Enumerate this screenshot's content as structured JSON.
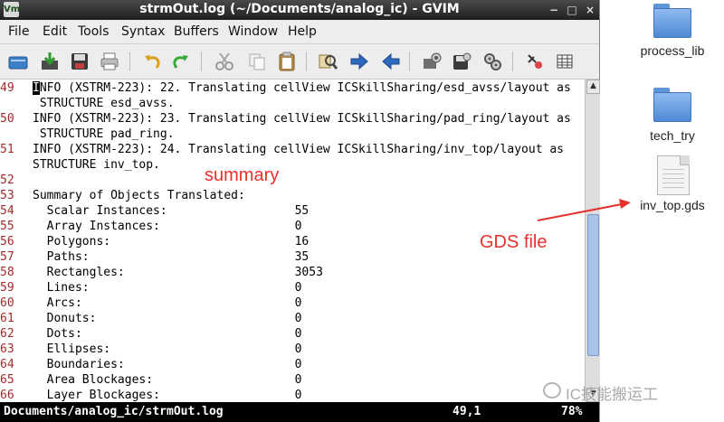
{
  "window": {
    "title": "strmOut.log (~/Documents/analog_ic) - GVIM",
    "logo_text": "Vm",
    "min_label": "−",
    "max_label": "□",
    "close_label": "×"
  },
  "menu": [
    "File",
    "Edit",
    "Tools",
    "Syntax",
    "Buffers",
    "Window",
    "Help"
  ],
  "toolbar_icons": [
    "open-icon",
    "save-icon",
    "save-all-icon",
    "print-icon",
    "undo-icon",
    "redo-icon",
    "cut-icon",
    "copy-icon",
    "paste-icon",
    "replace-icon",
    "forward-icon",
    "back-icon",
    "load-session-icon",
    "save-session-icon",
    "run-script-icon",
    "make-icon",
    "table-icon"
  ],
  "editor": {
    "lines": [
      {
        "num": "49",
        "text": "INFO (XSTRM-223): 22. Translating cellView ICSkillSharing/esd_avss/layout as"
      },
      {
        "num": "",
        "text": " STRUCTURE esd_avss."
      },
      {
        "num": "50",
        "text": "INFO (XSTRM-223): 23. Translating cellView ICSkillSharing/pad_ring/layout as"
      },
      {
        "num": "",
        "text": " STRUCTURE pad_ring."
      },
      {
        "num": "51",
        "text": "INFO (XSTRM-223): 24. Translating cellView ICSkillSharing/inv_top/layout as"
      },
      {
        "num": "",
        "text": "STRUCTURE inv_top."
      },
      {
        "num": "52",
        "text": ""
      },
      {
        "num": "53",
        "text": "Summary of Objects Translated:"
      },
      {
        "num": "54",
        "text": "  Scalar Instances:                  55"
      },
      {
        "num": "55",
        "text": "  Array Instances:                   0"
      },
      {
        "num": "56",
        "text": "  Polygons:                          16"
      },
      {
        "num": "57",
        "text": "  Paths:                             35"
      },
      {
        "num": "58",
        "text": "  Rectangles:                        3053"
      },
      {
        "num": "59",
        "text": "  Lines:                             0"
      },
      {
        "num": "60",
        "text": "  Arcs:                              0"
      },
      {
        "num": "61",
        "text": "  Donuts:                            0"
      },
      {
        "num": "62",
        "text": "  Dots:                              0"
      },
      {
        "num": "63",
        "text": "  Ellipses:                          0"
      },
      {
        "num": "64",
        "text": "  Boundaries:                        0"
      },
      {
        "num": "65",
        "text": "  Area Blockages:                    0"
      },
      {
        "num": "66",
        "text": "  Layer Blockages:                   0"
      }
    ]
  },
  "scroll_up": "▲",
  "scroll_down": "▼",
  "scroll_position": 0.78,
  "status": {
    "file": "Documents/analog_ic/strmOut.log",
    "position": "49,1",
    "percent": "78%"
  },
  "annotations": {
    "summary": "summary",
    "gds": "GDS file"
  },
  "desktop": {
    "items": [
      "process_lib",
      "tech_try",
      "inv_top.gds"
    ]
  },
  "watermark": "IC技能搬运工",
  "colors": {
    "annotation": "#e8302a",
    "line_number": "#a52a2a",
    "folder": "#5d95d8"
  }
}
